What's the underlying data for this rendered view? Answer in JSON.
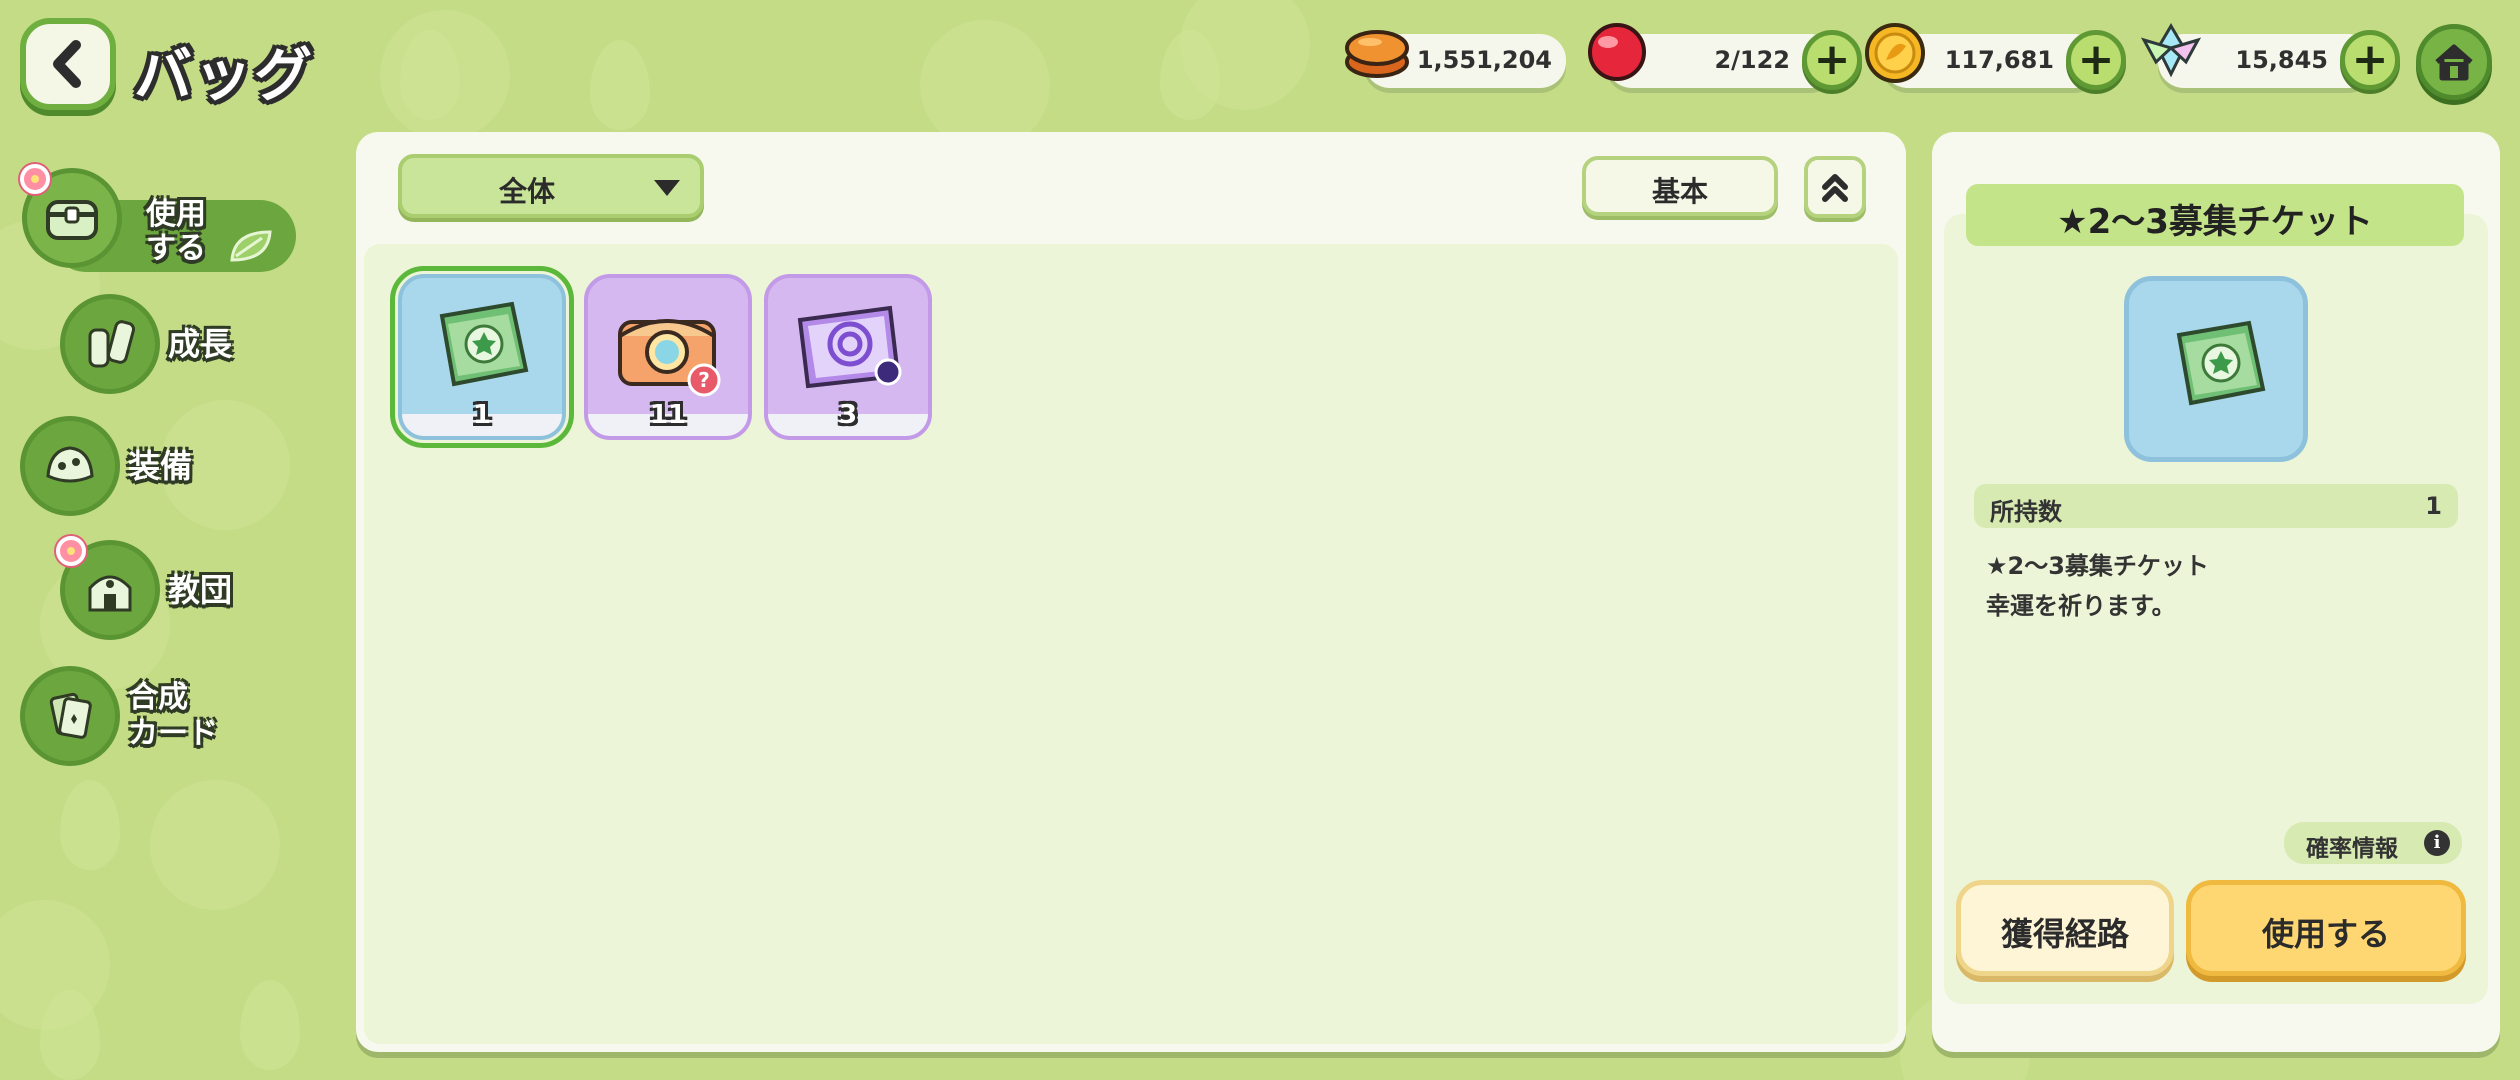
{
  "header": {
    "title": "バッグ"
  },
  "currencies": [
    {
      "name": "cookie-currency",
      "value": "1,551,204",
      "has_plus": false
    },
    {
      "name": "red-gem-currency",
      "value": "2/122",
      "has_plus": true
    },
    {
      "name": "gold-coin-currency",
      "value": "117,681",
      "has_plus": true
    },
    {
      "name": "crystal-currency",
      "value": "15,845",
      "has_plus": true
    }
  ],
  "sidebar": {
    "items": [
      {
        "label_line1": "使用",
        "label_line2": "する",
        "active": true
      },
      {
        "label_line1": "成長",
        "label_line2": ""
      },
      {
        "label_line1": "装備",
        "label_line2": ""
      },
      {
        "label_line1": "教団",
        "label_line2": ""
      },
      {
        "label_line1": "合成",
        "label_line2": "カード"
      }
    ]
  },
  "toolbar": {
    "filter_label": "全体",
    "sort_label": "基本"
  },
  "inventory": [
    {
      "count": "1",
      "frame": "blue",
      "icon": "green-ticket-icon",
      "selected": true
    },
    {
      "count": "11",
      "frame": "purple",
      "icon": "treasure-chest-icon",
      "selected": false
    },
    {
      "count": "3",
      "frame": "purple",
      "icon": "purple-ticket-icon",
      "selected": false
    }
  ],
  "detail": {
    "title": "★2～3募集チケット",
    "owned_label": "所持数",
    "owned_value": "1",
    "desc_line1": "★2～3募集チケット",
    "desc_line2": "幸運を祈ります。",
    "probability_label": "確率情報",
    "route_button": "獲得経路",
    "use_button": "使用する"
  },
  "colors": {
    "background": "#c3dc85",
    "accent_green": "#6ca63e",
    "use_button": "#ffd772",
    "slot_blue": "#a9d8ec",
    "slot_purple": "#d6b8f1"
  }
}
